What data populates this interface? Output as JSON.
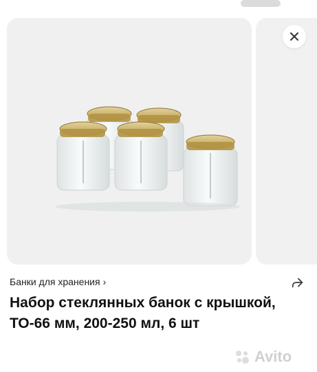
{
  "breadcrumb": {
    "label": "Банки для хранения",
    "chevron": "›"
  },
  "product": {
    "title": "Набор стеклянных банок с крышкой, ТО-66 мм, 200-250 мл, 6 шт"
  },
  "watermark": {
    "text": "Avito"
  },
  "icons": {
    "close": "close-icon",
    "share": "share-icon"
  },
  "colors": {
    "background": "#ffffff",
    "card": "#f0f0f0",
    "lid": "#d8c07a",
    "title": "#111111"
  }
}
